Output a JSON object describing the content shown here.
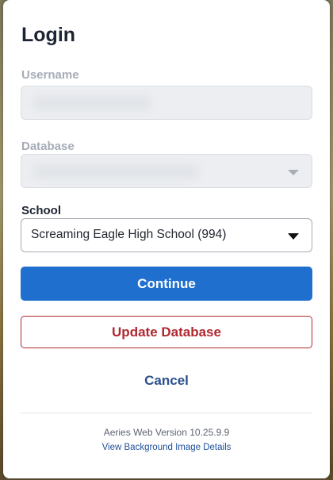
{
  "login": {
    "title": "Login",
    "username": {
      "label": "Username"
    },
    "database": {
      "label": "Database"
    },
    "school": {
      "label": "School",
      "selected": "Screaming Eagle High School (994)"
    }
  },
  "actions": {
    "continue_label": "Continue",
    "update_database_label": "Update Database",
    "cancel_label": "Cancel"
  },
  "footer": {
    "version": "Aeries Web Version 10.25.9.9",
    "background_link": "View Background Image Details"
  },
  "colors": {
    "primary": "#1f6fcf",
    "danger": "#b0282f",
    "link": "#2c4f8c"
  }
}
